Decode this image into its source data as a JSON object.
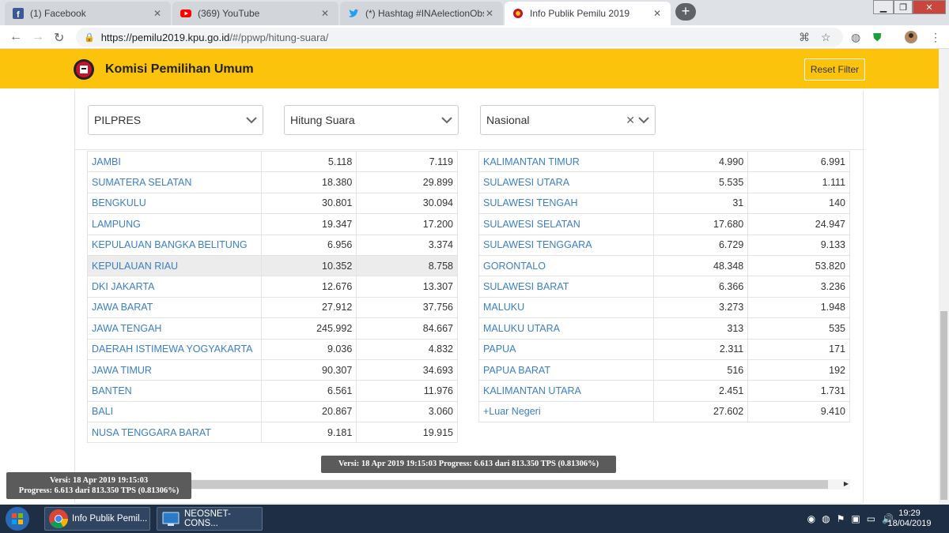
{
  "browser": {
    "tabs": [
      {
        "title": "(1) Facebook",
        "icon": "facebook-icon",
        "color": "#3b5998"
      },
      {
        "title": "(369) YouTube",
        "icon": "youtube-icon",
        "color": "#ff0000"
      },
      {
        "title": "(*) Hashtag #INAelectionObserve",
        "icon": "twitter-icon",
        "color": "#1da1f2"
      },
      {
        "title": "Info Publik Pemilu 2019",
        "icon": "kpu-icon",
        "color": "#c8102e"
      }
    ],
    "url_host": "https://pemilu2019.kpu.go.id",
    "url_path": "/#/ppwp/hitung-suara/"
  },
  "site": {
    "brand": "Komisi Pemilihan Umum",
    "reset_label": "Reset Filter",
    "header_color": "#fcc30c",
    "link_color": "#3b7fc4"
  },
  "filters": {
    "election": "PILPRES",
    "mode": "Hitung Suara",
    "region": "Nasional"
  },
  "table_left": [
    {
      "name": "JAMBI",
      "a": "5.118",
      "b": "7.119"
    },
    {
      "name": "SUMATERA SELATAN",
      "a": "18.380",
      "b": "29.899"
    },
    {
      "name": "BENGKULU",
      "a": "30.801",
      "b": "30.094"
    },
    {
      "name": "LAMPUNG",
      "a": "19.347",
      "b": "17.200"
    },
    {
      "name": "KEPULAUAN BANGKA BELITUNG",
      "a": "6.956",
      "b": "3.374"
    },
    {
      "name": "KEPULAUAN RIAU",
      "a": "10.352",
      "b": "8.758"
    },
    {
      "name": "DKI JAKARTA",
      "a": "12.676",
      "b": "13.307"
    },
    {
      "name": "JAWA BARAT",
      "a": "27.912",
      "b": "37.756"
    },
    {
      "name": "JAWA TENGAH",
      "a": "245.992",
      "b": "84.667"
    },
    {
      "name": "DAERAH ISTIMEWA YOGYAKARTA",
      "a": "9.036",
      "b": "4.832"
    },
    {
      "name": "JAWA TIMUR",
      "a": "90.307",
      "b": "34.693"
    },
    {
      "name": "BANTEN",
      "a": "6.561",
      "b": "11.976"
    },
    {
      "name": "BALI",
      "a": "20.867",
      "b": "3.060"
    },
    {
      "name": "NUSA TENGGARA BARAT",
      "a": "9.181",
      "b": "19.915"
    }
  ],
  "table_right": [
    {
      "name": "KALIMANTAN TIMUR",
      "a": "4.990",
      "b": "6.991"
    },
    {
      "name": "SULAWESI UTARA",
      "a": "5.535",
      "b": "1.111"
    },
    {
      "name": "SULAWESI TENGAH",
      "a": "31",
      "b": "140"
    },
    {
      "name": "SULAWESI SELATAN",
      "a": "17.680",
      "b": "24.947"
    },
    {
      "name": "SULAWESI TENGGARA",
      "a": "6.729",
      "b": "9.133"
    },
    {
      "name": "GORONTALO",
      "a": "48.348",
      "b": "53.820"
    },
    {
      "name": "SULAWESI BARAT",
      "a": "6.366",
      "b": "3.236"
    },
    {
      "name": "MALUKU",
      "a": "3.273",
      "b": "1.948"
    },
    {
      "name": "MALUKU UTARA",
      "a": "313",
      "b": "535"
    },
    {
      "name": "PAPUA",
      "a": "2.311",
      "b": "171"
    },
    {
      "name": "PAPUA BARAT",
      "a": "516",
      "b": "192"
    },
    {
      "name": "KALIMANTAN UTARA",
      "a": "2.451",
      "b": "1.731"
    },
    {
      "name": "+Luar Negeri",
      "a": "27.602",
      "b": "9.410"
    }
  ],
  "tooltip": "Versi: 18 Apr 2019 19:15:03 Progress: 6.613 dari 813.350 TPS (0.81306%)",
  "status_bubble": {
    "line1": "Versi: 18 Apr 2019 19:15:03",
    "line2": "Progress: 6.613 dari 813.350 TPS (0.81306%)"
  },
  "taskbar": {
    "tasks": [
      {
        "title": "Info Publik Pemil...",
        "icon": "chrome-icon"
      },
      {
        "title": "NEOSNET-CONS...",
        "icon": "remote-desktop-icon"
      }
    ],
    "time": "19:29",
    "date": "18/04/2019"
  }
}
